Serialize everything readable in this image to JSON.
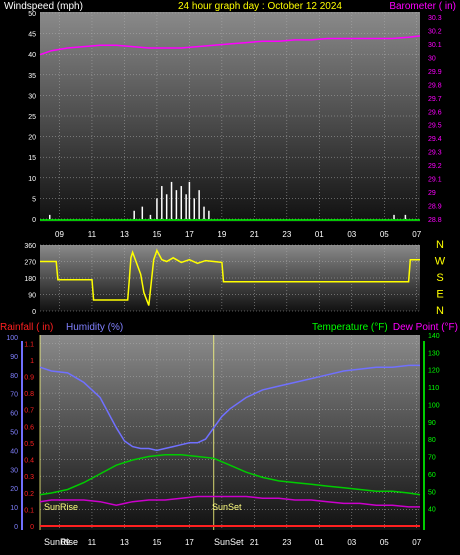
{
  "title": {
    "windspeed": "Windspeed (mph)",
    "period": "24 hour graph day : October 12 2024",
    "barometer": "Barometer ( in)",
    "rainfall": "Rainfall ( in)",
    "humidity": "Humidity (%)",
    "temperature": "Temperature (°F)",
    "dewpoint": "Dew Point (°F)",
    "sunrise": "SunRise",
    "sunset": "SunSet"
  },
  "colors": {
    "wind": "#ffffff",
    "gust": "#00ff00",
    "barometer": "#ff00ff",
    "direction": "#ffff00",
    "rain": "#ff2020",
    "humidity": "#7070ff",
    "temperature": "#00cc00",
    "dewpoint": "#cc00cc",
    "panel_top": "#8a8a8a",
    "panel_bottom": "#111111"
  },
  "chart_data": [
    {
      "type": "line",
      "panel": "wind-barometer",
      "x_ticks": [
        "09",
        "11",
        "13",
        "15",
        "17",
        "19",
        "21",
        "23",
        "01",
        "03",
        "05",
        "07"
      ],
      "wind_axis": {
        "min": 0,
        "max": 50,
        "ticks": [
          0,
          5,
          10,
          15,
          20,
          25,
          30,
          35,
          40,
          45,
          50
        ]
      },
      "barometer_axis": {
        "min": 28.8,
        "max": 30.3,
        "ticks": [
          "28.8",
          "28.9",
          "29",
          "29.1",
          "29.2",
          "29.3",
          "29.4",
          "29.5",
          "29.6",
          "29.7",
          "29.8",
          "29.9",
          "30",
          "30.1",
          "30.2",
          "30.3"
        ]
      },
      "hour_range": [
        7.8,
        31.2
      ],
      "series": [
        {
          "key": "barometer",
          "x": [
            7.8,
            8.5,
            9.5,
            10.5,
            11.5,
            12.5,
            13.5,
            14.5,
            15.5,
            16.5,
            17.5,
            18.5,
            19.5,
            20.5,
            21.5,
            22.5,
            23.5,
            24.5,
            25.5,
            26.5,
            27.5,
            28.5,
            29.5,
            30.5,
            31.2
          ],
          "values": [
            30.02,
            30.05,
            30.07,
            30.08,
            30.09,
            30.09,
            30.08,
            30.07,
            30.07,
            30.07,
            30.08,
            30.09,
            30.1,
            30.11,
            30.12,
            30.12,
            30.13,
            30.13,
            30.14,
            30.14,
            30.14,
            30.14,
            30.14,
            30.15,
            30.16
          ]
        },
        {
          "key": "wind",
          "x": [
            8.4,
            13.6,
            14.1,
            14.6,
            15.0,
            15.3,
            15.6,
            15.9,
            16.2,
            16.5,
            16.8,
            17.0,
            17.3,
            17.6,
            17.9,
            18.2,
            29.6,
            30.3
          ],
          "values": [
            1,
            2,
            3,
            1,
            5,
            8,
            6,
            9,
            7,
            8,
            6,
            9,
            5,
            7,
            3,
            2,
            1,
            1
          ]
        }
      ]
    },
    {
      "type": "line",
      "panel": "wind-direction",
      "axis": {
        "min": 0,
        "max": 360,
        "ticks": [
          0,
          90,
          180,
          270,
          360
        ]
      },
      "compass": [
        "N",
        "W",
        "S",
        "E",
        "N"
      ],
      "series": [
        {
          "key": "direction",
          "x": [
            7.8,
            8.8,
            8.9,
            11.0,
            11.1,
            13.2,
            13.3,
            13.4,
            13.5,
            14.0,
            14.2,
            14.5,
            14.8,
            15.0,
            15.3,
            15.6,
            16.0,
            16.5,
            17.0,
            17.5,
            18.0,
            18.5,
            19.0,
            19.1,
            30.5,
            30.6,
            31.2
          ],
          "values": [
            270,
            270,
            170,
            170,
            60,
            60,
            170,
            290,
            320,
            200,
            100,
            30,
            280,
            330,
            280,
            270,
            290,
            265,
            280,
            260,
            275,
            270,
            265,
            160,
            160,
            280,
            280
          ]
        }
      ]
    },
    {
      "type": "line",
      "panel": "rain-humidity-temp",
      "rain_axis": {
        "min": 0,
        "max": 1.15,
        "ticks": [
          "0",
          "0.1",
          "0.2",
          "0.3",
          "0.4",
          "0.5",
          "0.6",
          "0.7",
          "0.8",
          "0.9",
          "1",
          "1.1"
        ]
      },
      "humidity_axis": {
        "min": 0,
        "max": 100,
        "ticks": [
          0,
          10,
          20,
          30,
          40,
          50,
          60,
          70,
          80,
          90,
          100
        ]
      },
      "temperature_axis": {
        "min": 30,
        "max": 140,
        "ticks": [
          40,
          50,
          60,
          70,
          80,
          90,
          100,
          110,
          120,
          130,
          140
        ]
      },
      "x_labels": [
        "09",
        "11",
        "13",
        "15",
        "17",
        "19",
        "21",
        "23",
        "01",
        "03",
        "05",
        "07"
      ],
      "sunrise_hour": 7.8,
      "sunset_hour": 18.5,
      "series": [
        {
          "key": "humidity",
          "x": [
            7.8,
            8.5,
            9.5,
            10.5,
            11.5,
            12.0,
            12.5,
            13.0,
            13.5,
            14.0,
            14.5,
            15.0,
            15.5,
            16.0,
            16.5,
            17.0,
            17.5,
            18.0,
            18.5,
            19.0,
            19.5,
            20.5,
            21.5,
            22.5,
            23.5,
            24.5,
            25.5,
            26.5,
            27.5,
            28.5,
            29.5,
            30.5,
            31.2
          ],
          "values": [
            84,
            82,
            81,
            76,
            68,
            60,
            52,
            45,
            42,
            41,
            41,
            40,
            41,
            42,
            43,
            44,
            44,
            46,
            52,
            58,
            62,
            68,
            72,
            74,
            76,
            78,
            80,
            82,
            83,
            84,
            84,
            85,
            85
          ]
        },
        {
          "key": "temperature",
          "x": [
            7.8,
            8.5,
            9.5,
            10.5,
            11.5,
            12.5,
            13.5,
            14.5,
            15.5,
            16.5,
            17.5,
            18.5,
            19.5,
            20.5,
            21.5,
            22.5,
            23.5,
            24.5,
            25.5,
            26.5,
            27.5,
            28.5,
            29.5,
            30.5,
            31.2
          ],
          "values": [
            48,
            49,
            51,
            55,
            60,
            65,
            68,
            70,
            71,
            71,
            70,
            69,
            65,
            61,
            58,
            56,
            55,
            54,
            53,
            52,
            51,
            50,
            50,
            49,
            48
          ]
        },
        {
          "key": "dewpoint",
          "x": [
            7.8,
            8.5,
            9.5,
            10.5,
            11.5,
            12.5,
            13.5,
            14.5,
            15.5,
            16.5,
            17.5,
            18.5,
            19.5,
            20.5,
            21.5,
            22.5,
            23.5,
            24.5,
            25.5,
            26.5,
            27.5,
            28.5,
            29.5,
            30.5,
            31.2
          ],
          "values": [
            44,
            45,
            45,
            45,
            44,
            42,
            44,
            45,
            45,
            46,
            47,
            47,
            47,
            47,
            46,
            46,
            45,
            45,
            44,
            43,
            43,
            42,
            42,
            41,
            41
          ]
        },
        {
          "key": "rain",
          "x": [
            7.8,
            31.2
          ],
          "values": [
            0,
            0
          ]
        }
      ]
    }
  ]
}
